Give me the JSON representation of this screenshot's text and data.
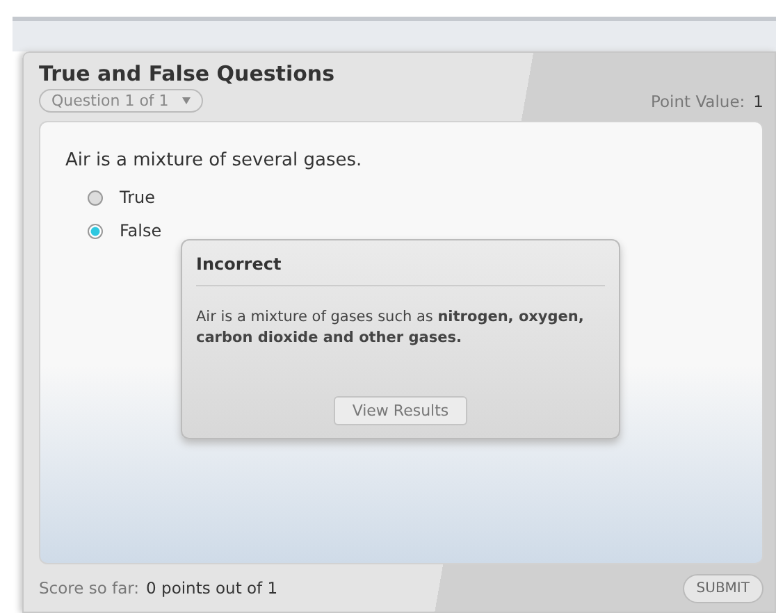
{
  "title": "True and False Questions",
  "question_selector": {
    "label": "Question 1 of 1"
  },
  "point_value": {
    "label": "Point Value:",
    "value": "1"
  },
  "question": "Air is a mixture of several gases.",
  "options": [
    {
      "label": "True",
      "selected": false
    },
    {
      "label": "False",
      "selected": true
    }
  ],
  "feedback": {
    "title": "Incorrect",
    "message": "Air is a mixture of gases such as **nitrogen, oxygen, carbon dioxide and other gases.**",
    "button": "View Results"
  },
  "score": {
    "label": "Score so far:",
    "value": "0 points out of 1"
  },
  "submit": "SUBMIT"
}
